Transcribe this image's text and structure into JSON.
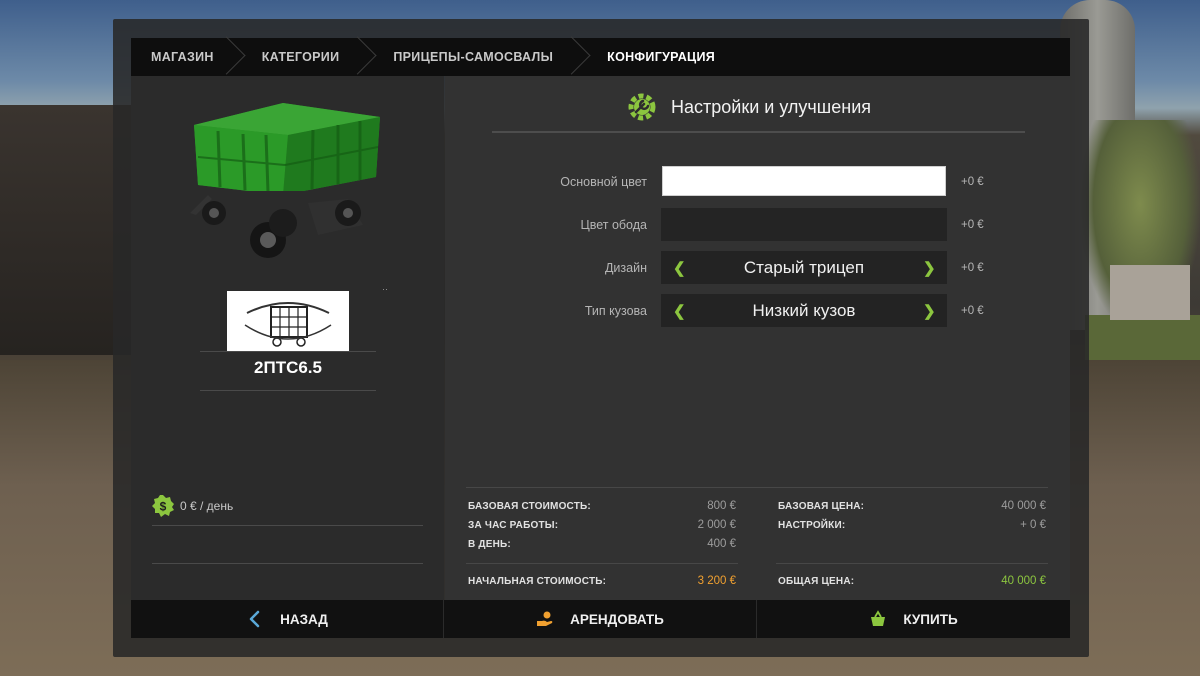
{
  "breadcrumb": [
    "МАГАЗИН",
    "КАТЕГОРИИ",
    "ПРИЦЕПЫ-САМОСВАЛЫ",
    "КОНФИГУРАЦИЯ"
  ],
  "item": {
    "name": "2ПТС6.5",
    "dots": "··"
  },
  "daily": {
    "text": "0 € / день"
  },
  "settings": {
    "title": "Настройки и улучшения"
  },
  "options": [
    {
      "label": "Основной цвет",
      "price": "+0 €",
      "type": "color",
      "color": "#ffffff"
    },
    {
      "label": "Цвет обода",
      "price": "+0 €",
      "type": "color",
      "color": "#242424"
    },
    {
      "label": "Дизайн",
      "value": "Старый трицеп",
      "price": "+0 €",
      "type": "selector"
    },
    {
      "label": "Тип кузова",
      "value": "Низкий кузов",
      "price": "+0 €",
      "type": "selector"
    }
  ],
  "costs": {
    "base_cost_label": "БАЗОВАЯ СТОИМОСТЬ:",
    "base_cost": "800 €",
    "per_hour_label": "ЗА ЧАС РАБОТЫ:",
    "per_hour": "2 000 €",
    "per_day_label": "В ДЕНЬ:",
    "per_day": "400 €",
    "initial_cost_label": "НАЧАЛЬНАЯ СТОИМОСТЬ:",
    "initial_cost": "3 200 €",
    "base_price_label": "БАЗОВАЯ ЦЕНА:",
    "base_price": "40 000 €",
    "settings_label": "НАСТРОЙКИ:",
    "settings_price": "+ 0 €",
    "total_label": "ОБЩАЯ ЦЕНА:",
    "total": "40 000 €"
  },
  "buttons": {
    "back": "НАЗАД",
    "rent": "АРЕНДОВАТЬ",
    "buy": "КУПИТЬ"
  },
  "colors": {
    "accent_green": "#8cc63f",
    "accent_orange": "#f0a030",
    "trailer_green": "#2f9a2a"
  }
}
